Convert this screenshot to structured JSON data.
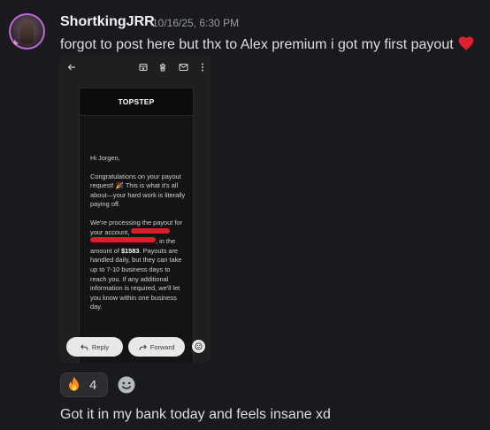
{
  "message": {
    "author": "ShortkingJRR",
    "timestamp": "10/16/25, 6:30 PM",
    "text": "forgot to post here but thx to Alex premium i got my first payout",
    "heart_emoji": "heart-icon",
    "followup_text": "Got it in my bank today and feels insane xd"
  },
  "attachment": {
    "toolbar_icons": [
      "back-arrow-icon",
      "archive-icon",
      "trash-icon",
      "mail-icon",
      "more-vertical-icon"
    ],
    "email": {
      "brand": "TOPSTEP",
      "greeting": "Hi Jorgen,",
      "para1": "Congratulations on your payout request! 🎉 This is what it's all about—your hard work is literally paying off.",
      "para2_a": "We're processing the payout for your account,",
      "para2_b": ", in the amount of",
      "amount": "$1583",
      "para2_c": ". Payouts are handled daily, but they can take up to 7-10 business days to reach you. If any additional information is required, we'll let you know within one business day."
    },
    "reply_label": "Reply",
    "forward_label": "Forward"
  },
  "reactions": [
    {
      "emoji": "🔥",
      "count": "4"
    }
  ],
  "colors": {
    "background": "#1a1a1e",
    "redaction": "#e21b2b",
    "heart": "#e0202f"
  }
}
